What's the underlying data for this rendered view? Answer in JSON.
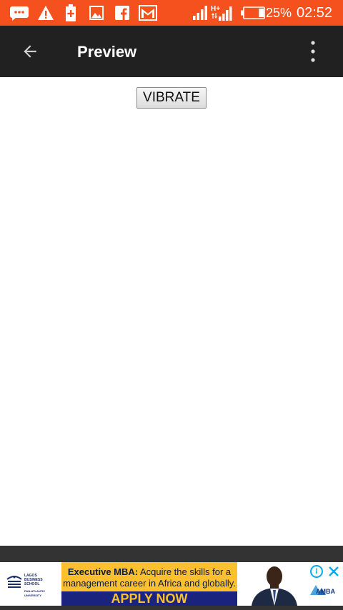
{
  "status_bar": {
    "battery_percent": "25%",
    "time": "02:52",
    "network_type": "H+",
    "battery_level": 0.25,
    "icons": [
      "messages-icon",
      "warning-icon",
      "battery-saver-icon",
      "gallery-icon",
      "facebook-icon",
      "gmail-icon",
      "signal-icon",
      "signal-hplus-icon",
      "battery-icon"
    ]
  },
  "app_bar": {
    "title": "Preview",
    "back_icon": "arrow-back-icon",
    "menu_icon": "more-vert-icon"
  },
  "content": {
    "vibrate_button": "VIBRATE"
  },
  "ad": {
    "headline_bold": "Executive MBA:",
    "headline_rest": " Acquire the skills for a management career in Africa and globally.",
    "cta": "APPLY NOW",
    "logo_line1": "LAGOS",
    "logo_line2": "BUSINESS",
    "logo_line3": "SCHOOL",
    "logo_line4": "PAN-ATLANTIC UNIVERSITY",
    "accreditation": "AMBA",
    "info_label": "i"
  },
  "colors": {
    "status_bar": "#f4511e",
    "app_bar": "#212121",
    "ad_yellow": "#fbc02d",
    "ad_navy": "#1a237e",
    "bottom_band": "#333333"
  }
}
